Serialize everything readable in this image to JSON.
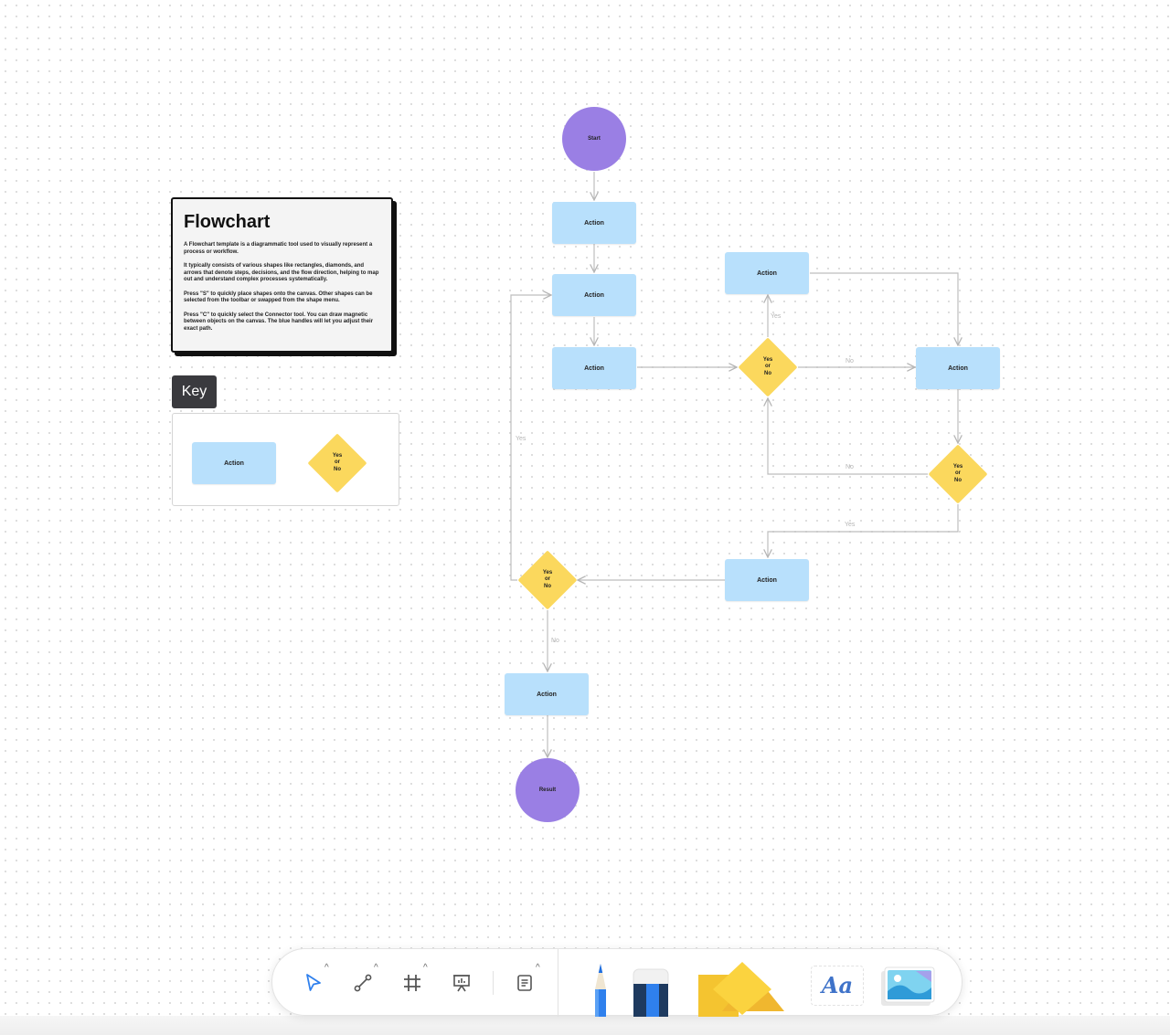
{
  "info_card": {
    "title": "Flowchart",
    "paragraphs": [
      "A Flowchart template is a diagrammatic tool used to visually represent a process or workflow.",
      "It typically consists of various shapes like rectangles, diamonds, and arrows that denote steps, decisions, and the flow direction, helping to map out and understand complex processes systematically.",
      "Press \"S\" to quickly place shapes onto the canvas. Other shapes can be selected from the toolbar or swapped from the shape menu.",
      "Press \"C\" to quickly select the Connector tool. You can draw magnetic between objects on the canvas. The blue handles will let you adjust their exact path."
    ]
  },
  "key": {
    "label": "Key",
    "action_label": "Action",
    "decision_label": "Yes\nor\nNo"
  },
  "flow": {
    "start": "Start",
    "result": "Result",
    "action": "Action",
    "decision": "Yes\nor\nNo",
    "yes": "Yes",
    "no": "No"
  },
  "colors": {
    "action": "#b8e0fc",
    "decision": "#fbd85d",
    "terminal": "#9a7fe4",
    "connector": "#bdbdbd"
  },
  "toolbar": {
    "tools": [
      "select-icon",
      "connector-icon",
      "section-icon",
      "presentation-icon",
      "sticky-note-icon",
      "pencil-icon",
      "eraser-icon",
      "shapes-icon",
      "text-icon",
      "image-icon"
    ],
    "text_tool_label": "Aa"
  }
}
